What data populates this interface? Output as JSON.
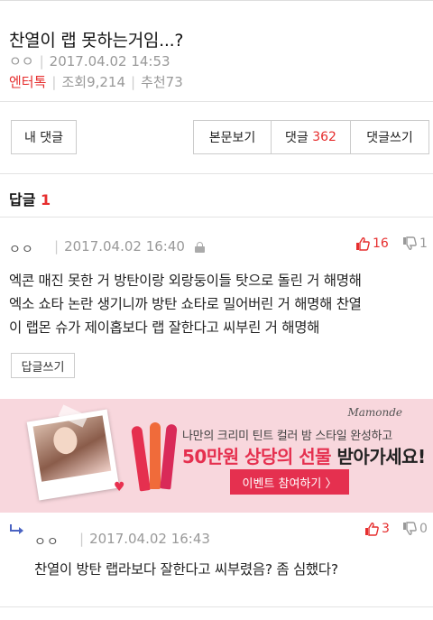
{
  "post": {
    "title": "찬열이 랩 못하는거임...?",
    "author": "ㅇㅇ",
    "date": "2017.04.02 14:53",
    "category": "엔터톡",
    "views": "조회9,214",
    "recommends": "추천73"
  },
  "buttons": {
    "my_comments": "내 댓글",
    "view_body": "본문보기",
    "comments_label": "댓글",
    "comments_count": "362",
    "write_comment": "댓글쓰기"
  },
  "section": {
    "label": "답글",
    "count": "1"
  },
  "comment": {
    "user": "ㅇㅇ",
    "date": "2017.04.02 16:40",
    "up": "16",
    "down": "1",
    "lines": [
      "엑콘 매진 못한 거 방탄이랑 외랑둥이들 탓으로 돌린 거 해명해",
      "엑소 쇼타 논란 생기니까 방탄 쇼타로 밀어버린 거 해명해 찬열",
      "이 랩몬 슈가 제이홉보다 랩 잘한다고 씨부린 거 해명해"
    ],
    "reply_button": "답글쓰기"
  },
  "ad": {
    "brand": "Mamonde",
    "line1": "나만의 크리미 틴트 컬러 밤 스타일 완성하고",
    "line2_red": "50만원 상당의 선물 ",
    "line2_dark": "받아가세요!",
    "button": "이벤트 참여하기  〉",
    "colors": {
      "background": "#f8d7dd",
      "accent": "#e5304f"
    }
  },
  "reply": {
    "user": "ㅇㅇ",
    "date": "2017.04.02 16:43",
    "up": "3",
    "down": "0",
    "text": "찬열이 방탄 랩라보다 잘한다고 씨부렸음? 좀 심했다?"
  },
  "colors": {
    "accent_red": "#e62e2e",
    "muted_gray": "#999999"
  }
}
